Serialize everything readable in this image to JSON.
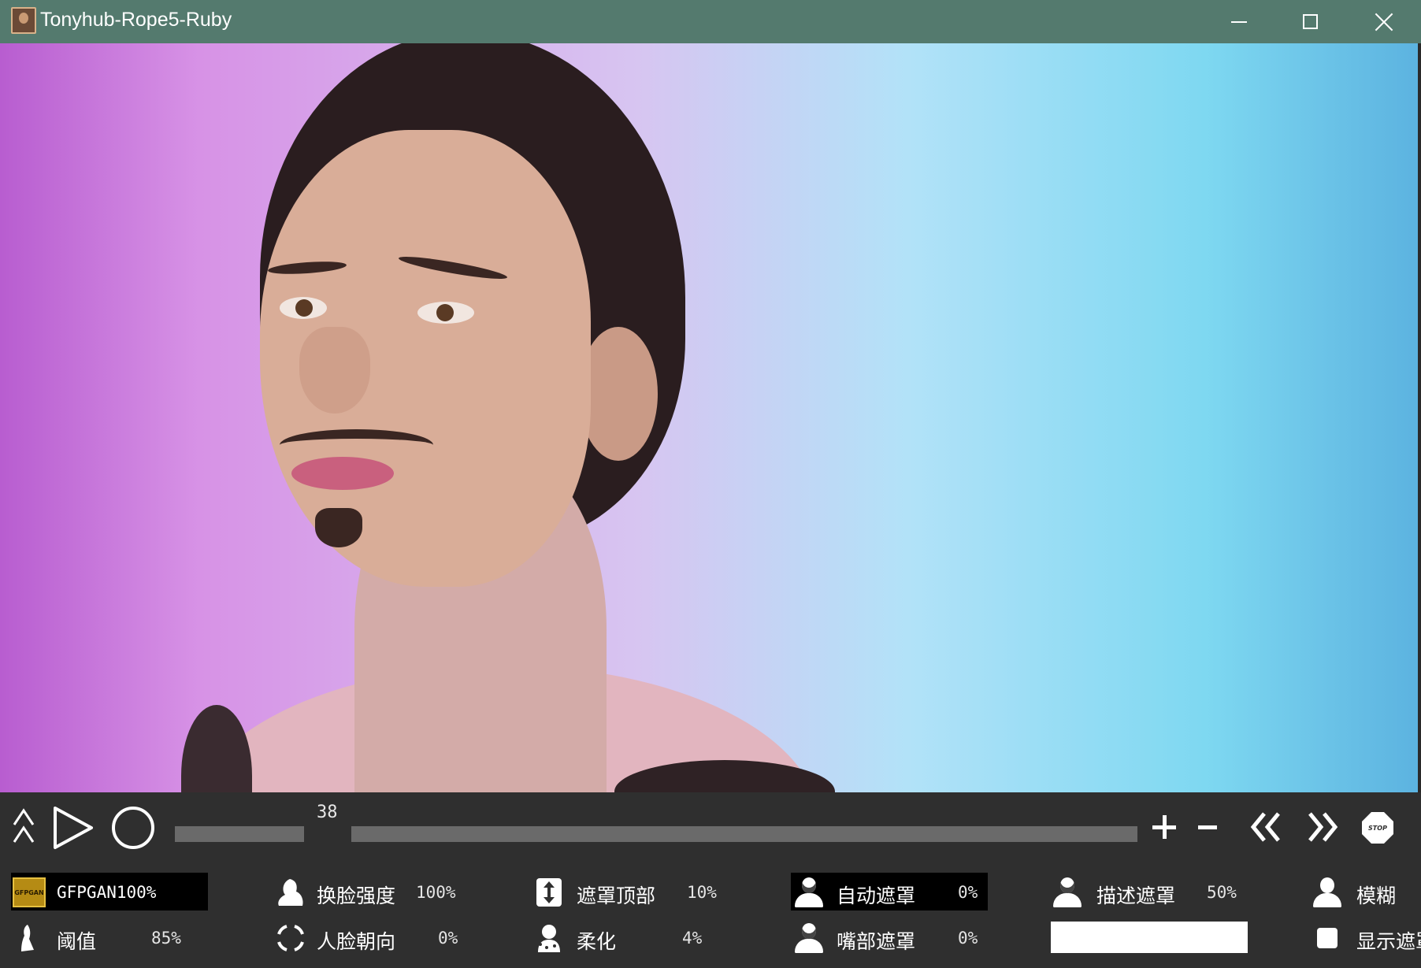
{
  "window": {
    "title": "Tonyhub-Rope5-Ruby"
  },
  "playback": {
    "frame": "38",
    "volume_level": 1.0,
    "timeline_progress": 0.0,
    "stop_label": "STOP"
  },
  "params": {
    "restorer": {
      "label": "GFPGAN100%",
      "badge": "GFPGAN"
    },
    "swap_strength": {
      "label": "换脸强度",
      "value": "100%"
    },
    "mask_top": {
      "label": "遮罩顶部",
      "value": "10%"
    },
    "auto_mask": {
      "label": "自动遮罩",
      "value": "0%"
    },
    "describe_mask": {
      "label": "描述遮罩",
      "value": "50%"
    },
    "blur": {
      "label": "模糊"
    },
    "threshold": {
      "label": "阈值",
      "value": "85%"
    },
    "face_orientation": {
      "label": "人脸朝向",
      "value": "0%"
    },
    "soften": {
      "label": "柔化",
      "value": "4%"
    },
    "mouth_mask": {
      "label": "嘴部遮罩",
      "value": "0%"
    },
    "mask_text": {
      "value": ""
    },
    "show_mask": {
      "label": "显示遮罩"
    }
  },
  "colors": {
    "titlebar": "#547a6e",
    "panel": "#2f2f2f",
    "slider": "#6a6a6a",
    "highlight": "#000000",
    "badge": "#b58b14"
  }
}
